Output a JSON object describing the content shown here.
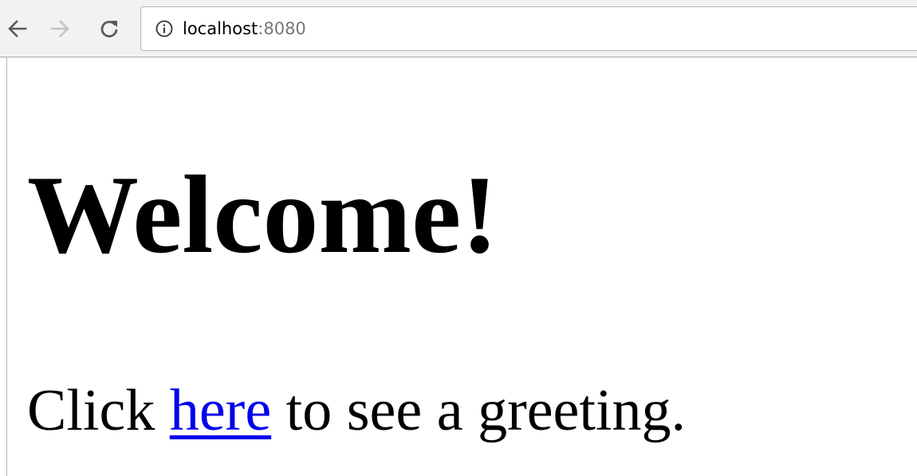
{
  "address_bar": {
    "host": "localhost",
    "port": ":8080"
  },
  "icons": {
    "back": "arrow-left-icon",
    "forward": "arrow-right-icon",
    "reload": "reload-icon",
    "site_info": "info-circle-icon"
  },
  "page": {
    "heading": "Welcome!",
    "paragraph": {
      "before_link": "Click ",
      "link_text": "here",
      "after_link": " to see a greeting."
    }
  },
  "colors": {
    "link": "#0000ee",
    "toolbar": "#f2f2f2",
    "port_text": "#777777"
  }
}
